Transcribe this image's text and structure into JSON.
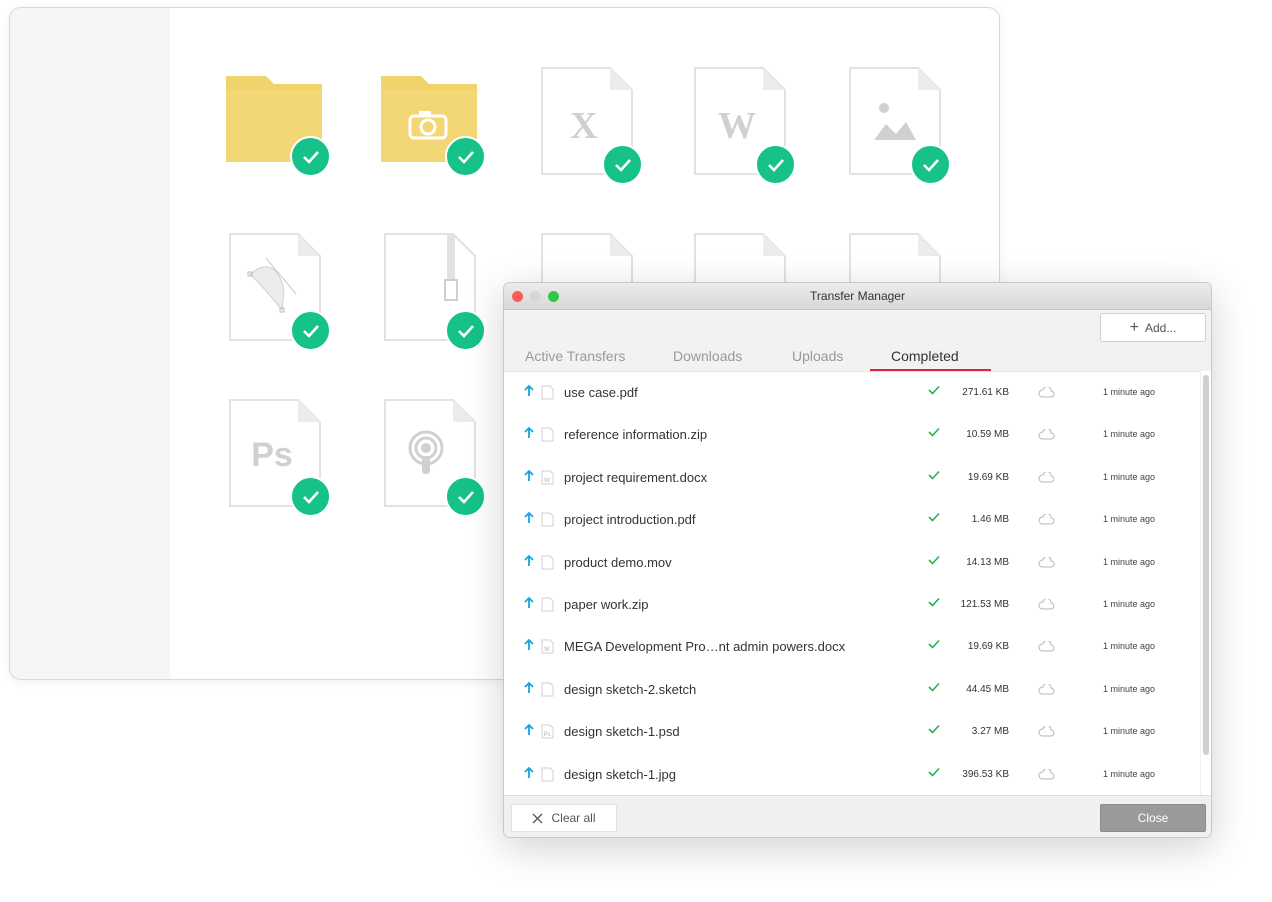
{
  "background_browser": {
    "tiles": [
      {
        "name": "folder-tile",
        "icon": "folder-icon"
      },
      {
        "name": "camera-folder-tile",
        "icon": "camera-folder-icon"
      },
      {
        "name": "excel-file-tile",
        "icon": "excel-file-icon",
        "glyph": "X"
      },
      {
        "name": "word-file-tile",
        "icon": "word-file-icon",
        "glyph": "W"
      },
      {
        "name": "image-file-tile",
        "icon": "image-file-icon"
      },
      {
        "name": "vector-file-tile",
        "icon": "vector-file-icon"
      },
      {
        "name": "zip-file-tile",
        "icon": "zip-file-icon"
      },
      {
        "name": "photoshop-file-tile",
        "icon": "photoshop-file-icon",
        "glyph": "Ps"
      },
      {
        "name": "podcast-file-tile",
        "icon": "podcast-file-icon"
      }
    ],
    "badge_color": "#16c28a",
    "folder_color": "#f0d36a"
  },
  "transfer_manager": {
    "title": "Transfer Manager",
    "add_label": "Add...",
    "tabs": [
      "Active Transfers",
      "Downloads",
      "Uploads",
      "Completed"
    ],
    "active_tab": "Completed",
    "accent_color": "#e0243a",
    "rows": [
      {
        "name": "use case.pdf",
        "type": "pdf",
        "size": "271.61 KB",
        "time": "1 minute ago"
      },
      {
        "name": "reference information.zip",
        "type": "zip",
        "size": "10.59 MB",
        "time": "1 minute ago"
      },
      {
        "name": "project requirement.docx",
        "type": "word",
        "size": "19.69 KB",
        "time": "1 minute ago"
      },
      {
        "name": "project introduction.pdf",
        "type": "pdf",
        "size": "1.46 MB",
        "time": "1 minute ago"
      },
      {
        "name": "product demo.mov",
        "type": "video",
        "size": "14.13 MB",
        "time": "1 minute ago"
      },
      {
        "name": "paper work.zip",
        "type": "zip",
        "size": "121.53 MB",
        "time": "1 minute ago"
      },
      {
        "name": "MEGA Development Pro…nt admin powers.docx",
        "type": "word",
        "size": "19.69 KB",
        "time": "1 minute ago"
      },
      {
        "name": "design sketch-2.sketch",
        "type": "generic",
        "size": "44.45 MB",
        "time": "1 minute ago"
      },
      {
        "name": "design sketch-1.psd",
        "type": "photoshop",
        "size": "3.27 MB",
        "time": "1 minute ago"
      },
      {
        "name": "design sketch-1.jpg",
        "type": "image",
        "size": "396.53 KB",
        "time": "1 minute ago"
      }
    ],
    "clear_all_label": "Clear all",
    "close_label": "Close"
  }
}
